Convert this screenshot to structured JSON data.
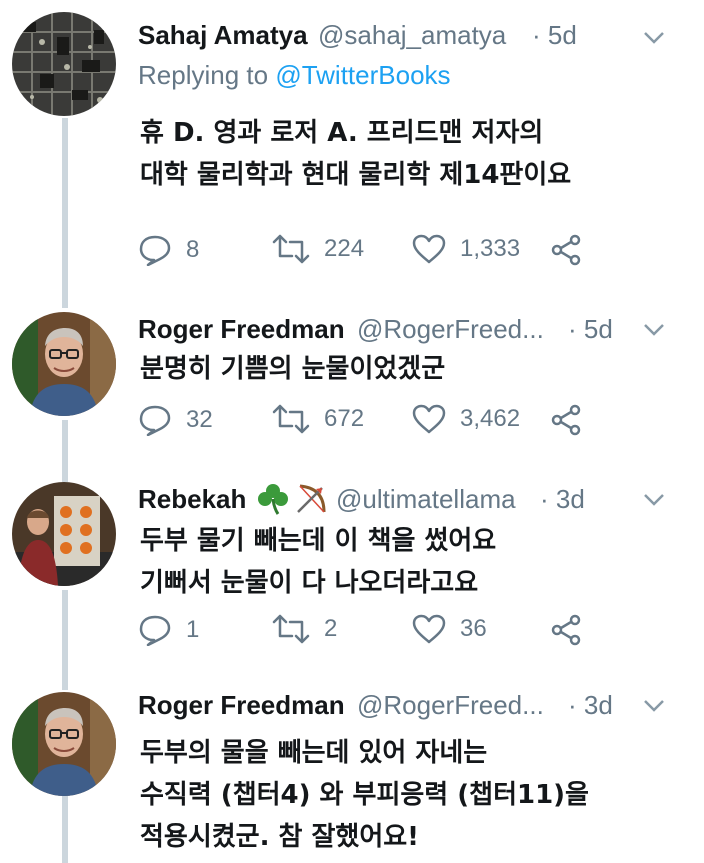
{
  "tweets": [
    {
      "name": "Sahaj Amatya",
      "handle": "@sahaj_amatya",
      "time": "· 5d",
      "replying_prefix": "Replying to ",
      "replying_handle": "@TwitterBooks",
      "lines": [
        "휴 D. 영과 로저 A. 프리드맨 저자의",
        "대학 물리학과 현대 물리학 제14판이요"
      ],
      "replies": "8",
      "retweets": "224",
      "likes": "1,333"
    },
    {
      "name": "Roger Freedman",
      "handle": "@RogerFreed...",
      "time": "· 5d",
      "lines": [
        "분명히 기쁨의 눈물이었겠군"
      ],
      "replies": "32",
      "retweets": "672",
      "likes": "3,462"
    },
    {
      "name": "Rebekah",
      "handle": "@ultimatellama",
      "time": "· 3d",
      "lines": [
        "두부 물기 빼는데 이 책을 썼어요",
        "기뻐서 눈물이 다 나오더라고요"
      ],
      "replies": "1",
      "retweets": "2",
      "likes": "36"
    },
    {
      "name": "Roger Freedman",
      "handle": "@RogerFreed...",
      "time": "· 3d",
      "lines": [
        "두부의 물을 빼는데 있어 자네는",
        "수직력 (챕터4) 와 부피응력 (챕터11)을",
        "적용시켰군. 참 잘했어요!"
      ]
    }
  ],
  "icons": {
    "reply": "reply-icon",
    "retweet": "retweet-icon",
    "like": "heart-icon",
    "share": "share-icon",
    "more": "chevron-down-icon",
    "emoji1": "shamrock-icon",
    "emoji2": "bow-and-arrow-icon"
  },
  "colors": {
    "muted": "#657786",
    "link": "#1da1f2",
    "line": "#ccd6dd"
  }
}
